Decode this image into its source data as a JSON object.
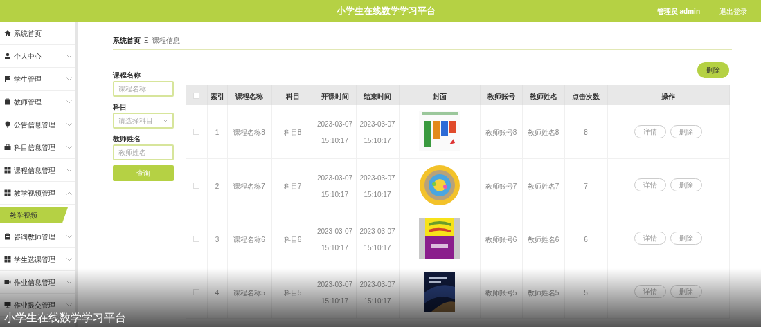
{
  "header": {
    "title": "小学生在线数学学习平台",
    "user": "管理员 admin",
    "logout": "退出登录"
  },
  "sidebar": {
    "items": [
      {
        "label": "系统首页",
        "kind": "home"
      },
      {
        "label": "个人中心",
        "kind": "user",
        "expanded": false
      },
      {
        "label": "学生管理",
        "kind": "flag",
        "expanded": false
      },
      {
        "label": "教师管理",
        "kind": "clipboard",
        "expanded": false
      },
      {
        "label": "公告信息管理",
        "kind": "pin",
        "expanded": false
      },
      {
        "label": "科目信息管理",
        "kind": "briefcase",
        "expanded": false
      },
      {
        "label": "课程信息管理",
        "kind": "grid",
        "expanded": false
      },
      {
        "label": "教学视频管理",
        "kind": "grid",
        "expanded": true,
        "children": [
          {
            "label": "教学视频",
            "selected": true
          }
        ]
      },
      {
        "label": "咨询教师管理",
        "kind": "clipboard",
        "expanded": false
      },
      {
        "label": "学生选课管理",
        "kind": "grid",
        "expanded": false
      },
      {
        "label": "作业信息管理",
        "kind": "video",
        "expanded": false
      },
      {
        "label": "作业提交管理",
        "kind": "monitor",
        "expanded": false
      }
    ]
  },
  "breadcrumb": {
    "home": "系统首页",
    "separator": "Ξ",
    "current": "课程信息"
  },
  "search": {
    "fields": [
      {
        "label": "课程名称",
        "kind": "input",
        "placeholder": "课程名称"
      },
      {
        "label": "科目",
        "kind": "select",
        "placeholder": "请选择科目"
      },
      {
        "label": "教师姓名",
        "kind": "input",
        "placeholder": "教师姓名"
      }
    ],
    "button": "查询"
  },
  "delete_button": "删除",
  "table": {
    "select_all_checked": false,
    "columns": [
      "索引",
      "课程名称",
      "科目",
      "开课时间",
      "结束时间",
      "封面",
      "教师账号",
      "教师姓名",
      "点击次数",
      "操作"
    ],
    "rows": [
      {
        "checked": false,
        "index": "1",
        "name": "课程名称8",
        "subject": "科目8",
        "start": "2023-03-07 15:10:17",
        "end": "2023-03-07 15:10:17",
        "cover": {
          "kind": "picture"
        },
        "account": "教师账号8",
        "teacher": "教师姓名8",
        "clicks": "8",
        "actions": [
          "详情",
          "删除"
        ]
      },
      {
        "checked": false,
        "index": "2",
        "name": "课程名称7",
        "subject": "科目7",
        "start": "2023-03-07 15:10:17",
        "end": "2023-03-07 15:10:17",
        "cover": {
          "kind": "picture"
        },
        "account": "教师账号7",
        "teacher": "教师姓名7",
        "clicks": "7",
        "actions": [
          "详情",
          "删除"
        ]
      },
      {
        "checked": false,
        "index": "3",
        "name": "课程名称6",
        "subject": "科目6",
        "start": "2023-03-07 15:10:17",
        "end": "2023-03-07 15:10:17",
        "cover": {
          "kind": "picture"
        },
        "account": "教师账号6",
        "teacher": "教师姓名6",
        "clicks": "6",
        "actions": [
          "详情",
          "删除"
        ]
      },
      {
        "checked": false,
        "index": "4",
        "name": "课程名称5",
        "subject": "科目5",
        "start": "2023-03-07 15:10:17",
        "end": "2023-03-07 15:10:17",
        "cover": {
          "kind": "picture"
        },
        "account": "教师账号5",
        "teacher": "教师姓名5",
        "clicks": "5",
        "actions": [
          "详情",
          "删除"
        ]
      }
    ]
  },
  "video_caption": "小学生在线数学学习平台"
}
